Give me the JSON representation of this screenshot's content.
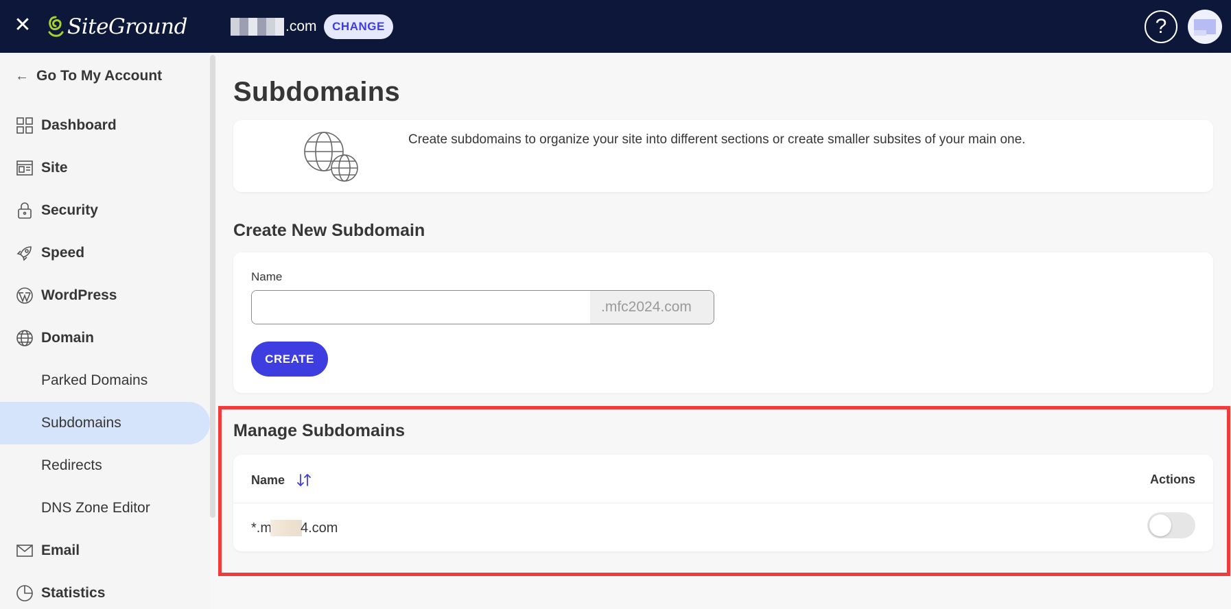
{
  "header": {
    "brand": "SiteGround",
    "site_domain_suffix": ".com",
    "change_label": "CHANGE",
    "help_label": "?"
  },
  "sidebar": {
    "back_label": "Go To My Account",
    "items": [
      {
        "label": "Dashboard",
        "icon": "dashboard-icon"
      },
      {
        "label": "Site",
        "icon": "site-icon"
      },
      {
        "label": "Security",
        "icon": "lock-icon"
      },
      {
        "label": "Speed",
        "icon": "rocket-icon"
      },
      {
        "label": "WordPress",
        "icon": "wordpress-icon"
      },
      {
        "label": "Domain",
        "icon": "globe-icon"
      }
    ],
    "domain_sub": [
      "Parked Domains",
      "Subdomains",
      "Redirects",
      "DNS Zone Editor"
    ],
    "active_sub": "Subdomains",
    "more_items": [
      {
        "label": "Email",
        "icon": "mail-icon"
      },
      {
        "label": "Statistics",
        "icon": "pie-chart-icon"
      }
    ]
  },
  "main": {
    "title": "Subdomains",
    "intro": "Create subdomains to organize your site into different sections or create smaller subsites of your main one.",
    "create_section": {
      "title": "Create New Subdomain",
      "name_label": "Name",
      "name_value": "",
      "suffix": ".mfc2024.com",
      "create_label": "CREATE"
    },
    "manage_section": {
      "title": "Manage Subdomains",
      "col_name": "Name",
      "col_actions": "Actions",
      "rows": [
        {
          "prefix": "*.m",
          "suffix": "4.com",
          "enabled": false
        }
      ]
    }
  },
  "colors": {
    "topbar": "#0c1739",
    "accent": "#3e3ee0",
    "active_nav": "#d5e3fb",
    "highlight": "#ef3b3b"
  }
}
